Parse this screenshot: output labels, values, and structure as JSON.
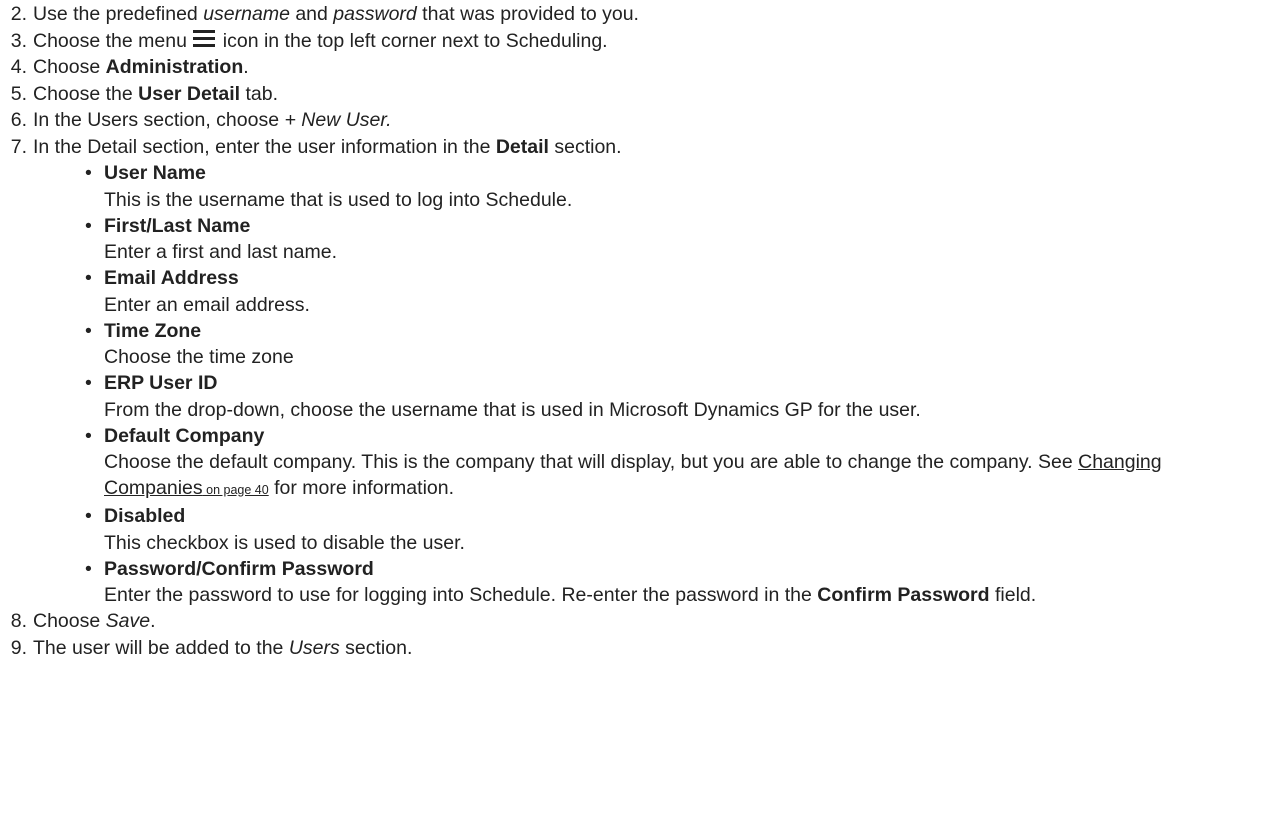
{
  "steps": [
    {
      "num": "2.",
      "parts": [
        "Use the predefined ",
        "username",
        " and ",
        "password",
        " that was provided to you."
      ]
    },
    {
      "num": "3.",
      "parts": [
        "Choose the menu ",
        " icon in the top left corner next to Scheduling."
      ],
      "icon": "hamburger-menu-icon"
    },
    {
      "num": "4.",
      "parts": [
        "Choose ",
        "Administration",
        "."
      ]
    },
    {
      "num": "5.",
      "parts": [
        "Choose the ",
        "User Detail",
        " tab."
      ]
    },
    {
      "num": "6.",
      "parts": [
        "In the Users section, choose ",
        "+ New User."
      ]
    },
    {
      "num": "7.",
      "parts": [
        "In the Detail section, enter the user information in the ",
        "Detail",
        " section."
      ]
    },
    {
      "num": "8.",
      "parts": [
        "Choose ",
        "Save",
        "."
      ]
    },
    {
      "num": "9.",
      "parts": [
        "The user will be added to the ",
        "Users",
        " section."
      ]
    }
  ],
  "fields": [
    {
      "title": "User Name",
      "desc": "This is the username that is used to log into Schedule."
    },
    {
      "title": "First/Last Name",
      "desc": "Enter a first and last name."
    },
    {
      "title": "Email Address",
      "desc": "Enter an email address."
    },
    {
      "title": "Time Zone",
      "desc": "Choose the time zone"
    },
    {
      "title": "ERP User ID",
      "desc": "From the drop-down, choose the username that is used in Microsoft Dynamics GP for the user."
    },
    {
      "title": "Default Company",
      "desc": "Choose the default company. This is the company that will display, but you are able to change the company. See ",
      "link_text": "Changing Companies",
      "link_page": " on page 40",
      "desc_after": " for more information."
    },
    {
      "title": "Disabled",
      "desc": "This checkbox is used to disable the user."
    },
    {
      "title": "Password/Confirm Password",
      "desc": "Enter the password to use for logging into Schedule. Re-enter the password in the ",
      "desc_bold": "Confirm Password",
      "desc_after": " field."
    }
  ],
  "bullet_char": "•"
}
